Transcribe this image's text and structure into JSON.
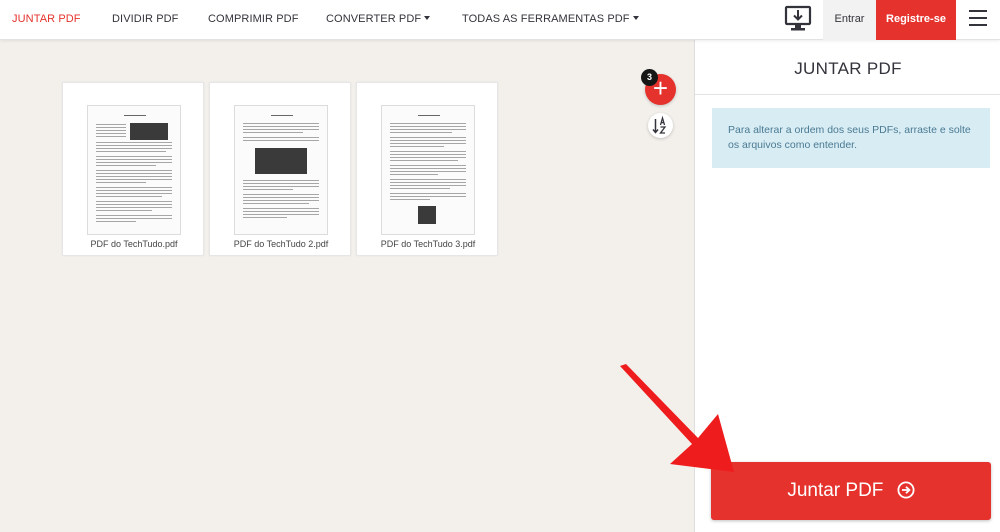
{
  "nav": {
    "items": [
      {
        "label": "JUNTAR PDF",
        "active": true
      },
      {
        "label": "DIVIDIR PDF"
      },
      {
        "label": "COMPRIMIR PDF"
      },
      {
        "label": "CONVERTER PDF"
      },
      {
        "label": "TODAS AS FERRAMENTAS PDF"
      }
    ],
    "desktop_icon": "desktop-download-icon",
    "login": "Entrar",
    "register": "Registre-se",
    "menu_icon": "hamburger-menu-icon"
  },
  "workspace": {
    "files": [
      {
        "name": "PDF do TechTudo.pdf"
      },
      {
        "name": "PDF do TechTudo 2.pdf"
      },
      {
        "name": "PDF do TechTudo 3.pdf"
      }
    ],
    "add_badge": "3",
    "add_icon": "plus-icon",
    "sort_icon": "sort-az-icon"
  },
  "sidebar": {
    "title": "JUNTAR PDF",
    "info": "Para alterar a ordem dos seus PDFs, arraste e solte os arquivos como entender.",
    "merge_button": "Juntar PDF",
    "merge_icon": "arrow-circle-right-icon"
  },
  "colors": {
    "accent": "#e5322d",
    "info_bg": "#d8ecf4",
    "workspace_bg": "#f3f0ec"
  }
}
